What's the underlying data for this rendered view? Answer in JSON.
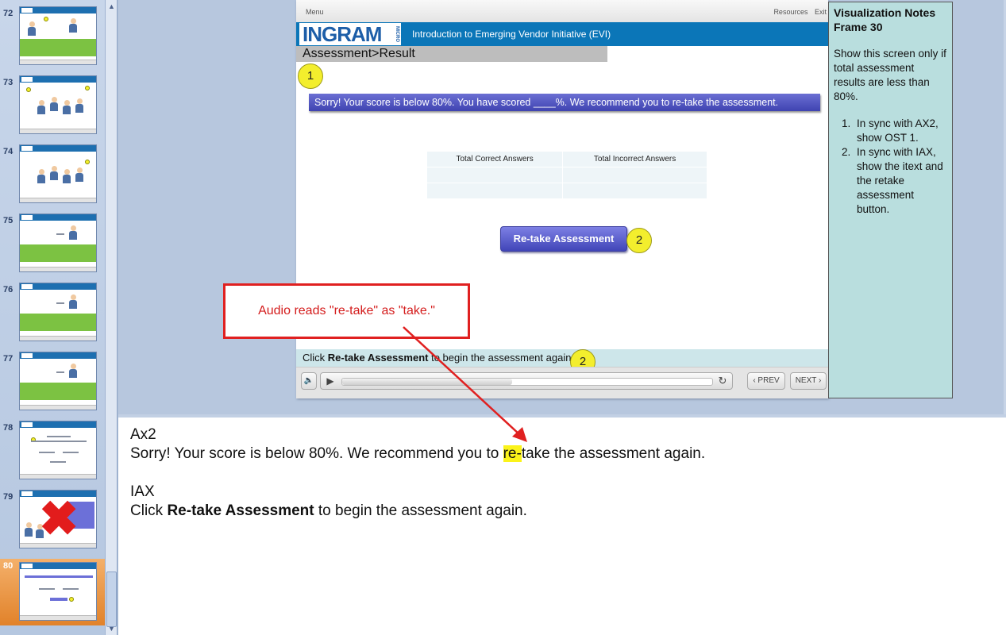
{
  "thumbnails": {
    "items": [
      {
        "number": "72"
      },
      {
        "number": "73"
      },
      {
        "number": "74"
      },
      {
        "number": "75"
      },
      {
        "number": "76"
      },
      {
        "number": "77"
      },
      {
        "number": "78"
      },
      {
        "number": "79"
      },
      {
        "number": "80",
        "selected": true
      }
    ]
  },
  "slide": {
    "menu_label": "Menu",
    "resources_label": "Resources",
    "exit_label": "Exit",
    "logo_text": "INGRAM",
    "logo_micro": "MICRO",
    "course_title": "Introduction to Emerging Vendor Initiative (EVI)",
    "breadcrumb": "Assessment>Result",
    "marker_1": "1",
    "marker_2": "2",
    "sorry_message": "Sorry! Your score is below 80%. You have scored ____%. We recommend you to re-take the assessment.",
    "table_headers": [
      "Total Correct Answers",
      "Total Incorrect Answers"
    ],
    "retake_button": "Re-take Assessment",
    "instruction_prefix": "Click ",
    "instruction_bold": "Re-take Assessment",
    "instruction_suffix": " to begin the assessment again.",
    "prev_label": "‹ PREV",
    "next_label": "NEXT ›",
    "progress_fraction": 0.46
  },
  "visualization_notes": {
    "title_line1": "Visualization Notes",
    "title_line2": "Frame 30",
    "intro": "Show this screen only if total assessment results are less than 80%.",
    "items": [
      "In sync with AX2, show OST 1.",
      "In sync with IAX, show the itext and the retake assessment button."
    ]
  },
  "callout": {
    "text": "Audio reads \"re-take\" as \"take.\""
  },
  "notes": {
    "ax_label": "Ax2",
    "ax_before": "Sorry! Your score is below 80%. We recommend you to ",
    "ax_highlight": "re-",
    "ax_after": "take the assessment again.",
    "iax_label": "IAX",
    "iax_prefix": "Click ",
    "iax_bold": "Re-take Assessment",
    "iax_suffix": " to begin the assessment again."
  },
  "colors": {
    "callout_red": "#e02020",
    "highlight_yellow": "#fbf31a",
    "marker_yellow": "#f3ee2d",
    "banner_blue": "#0b76b8"
  }
}
